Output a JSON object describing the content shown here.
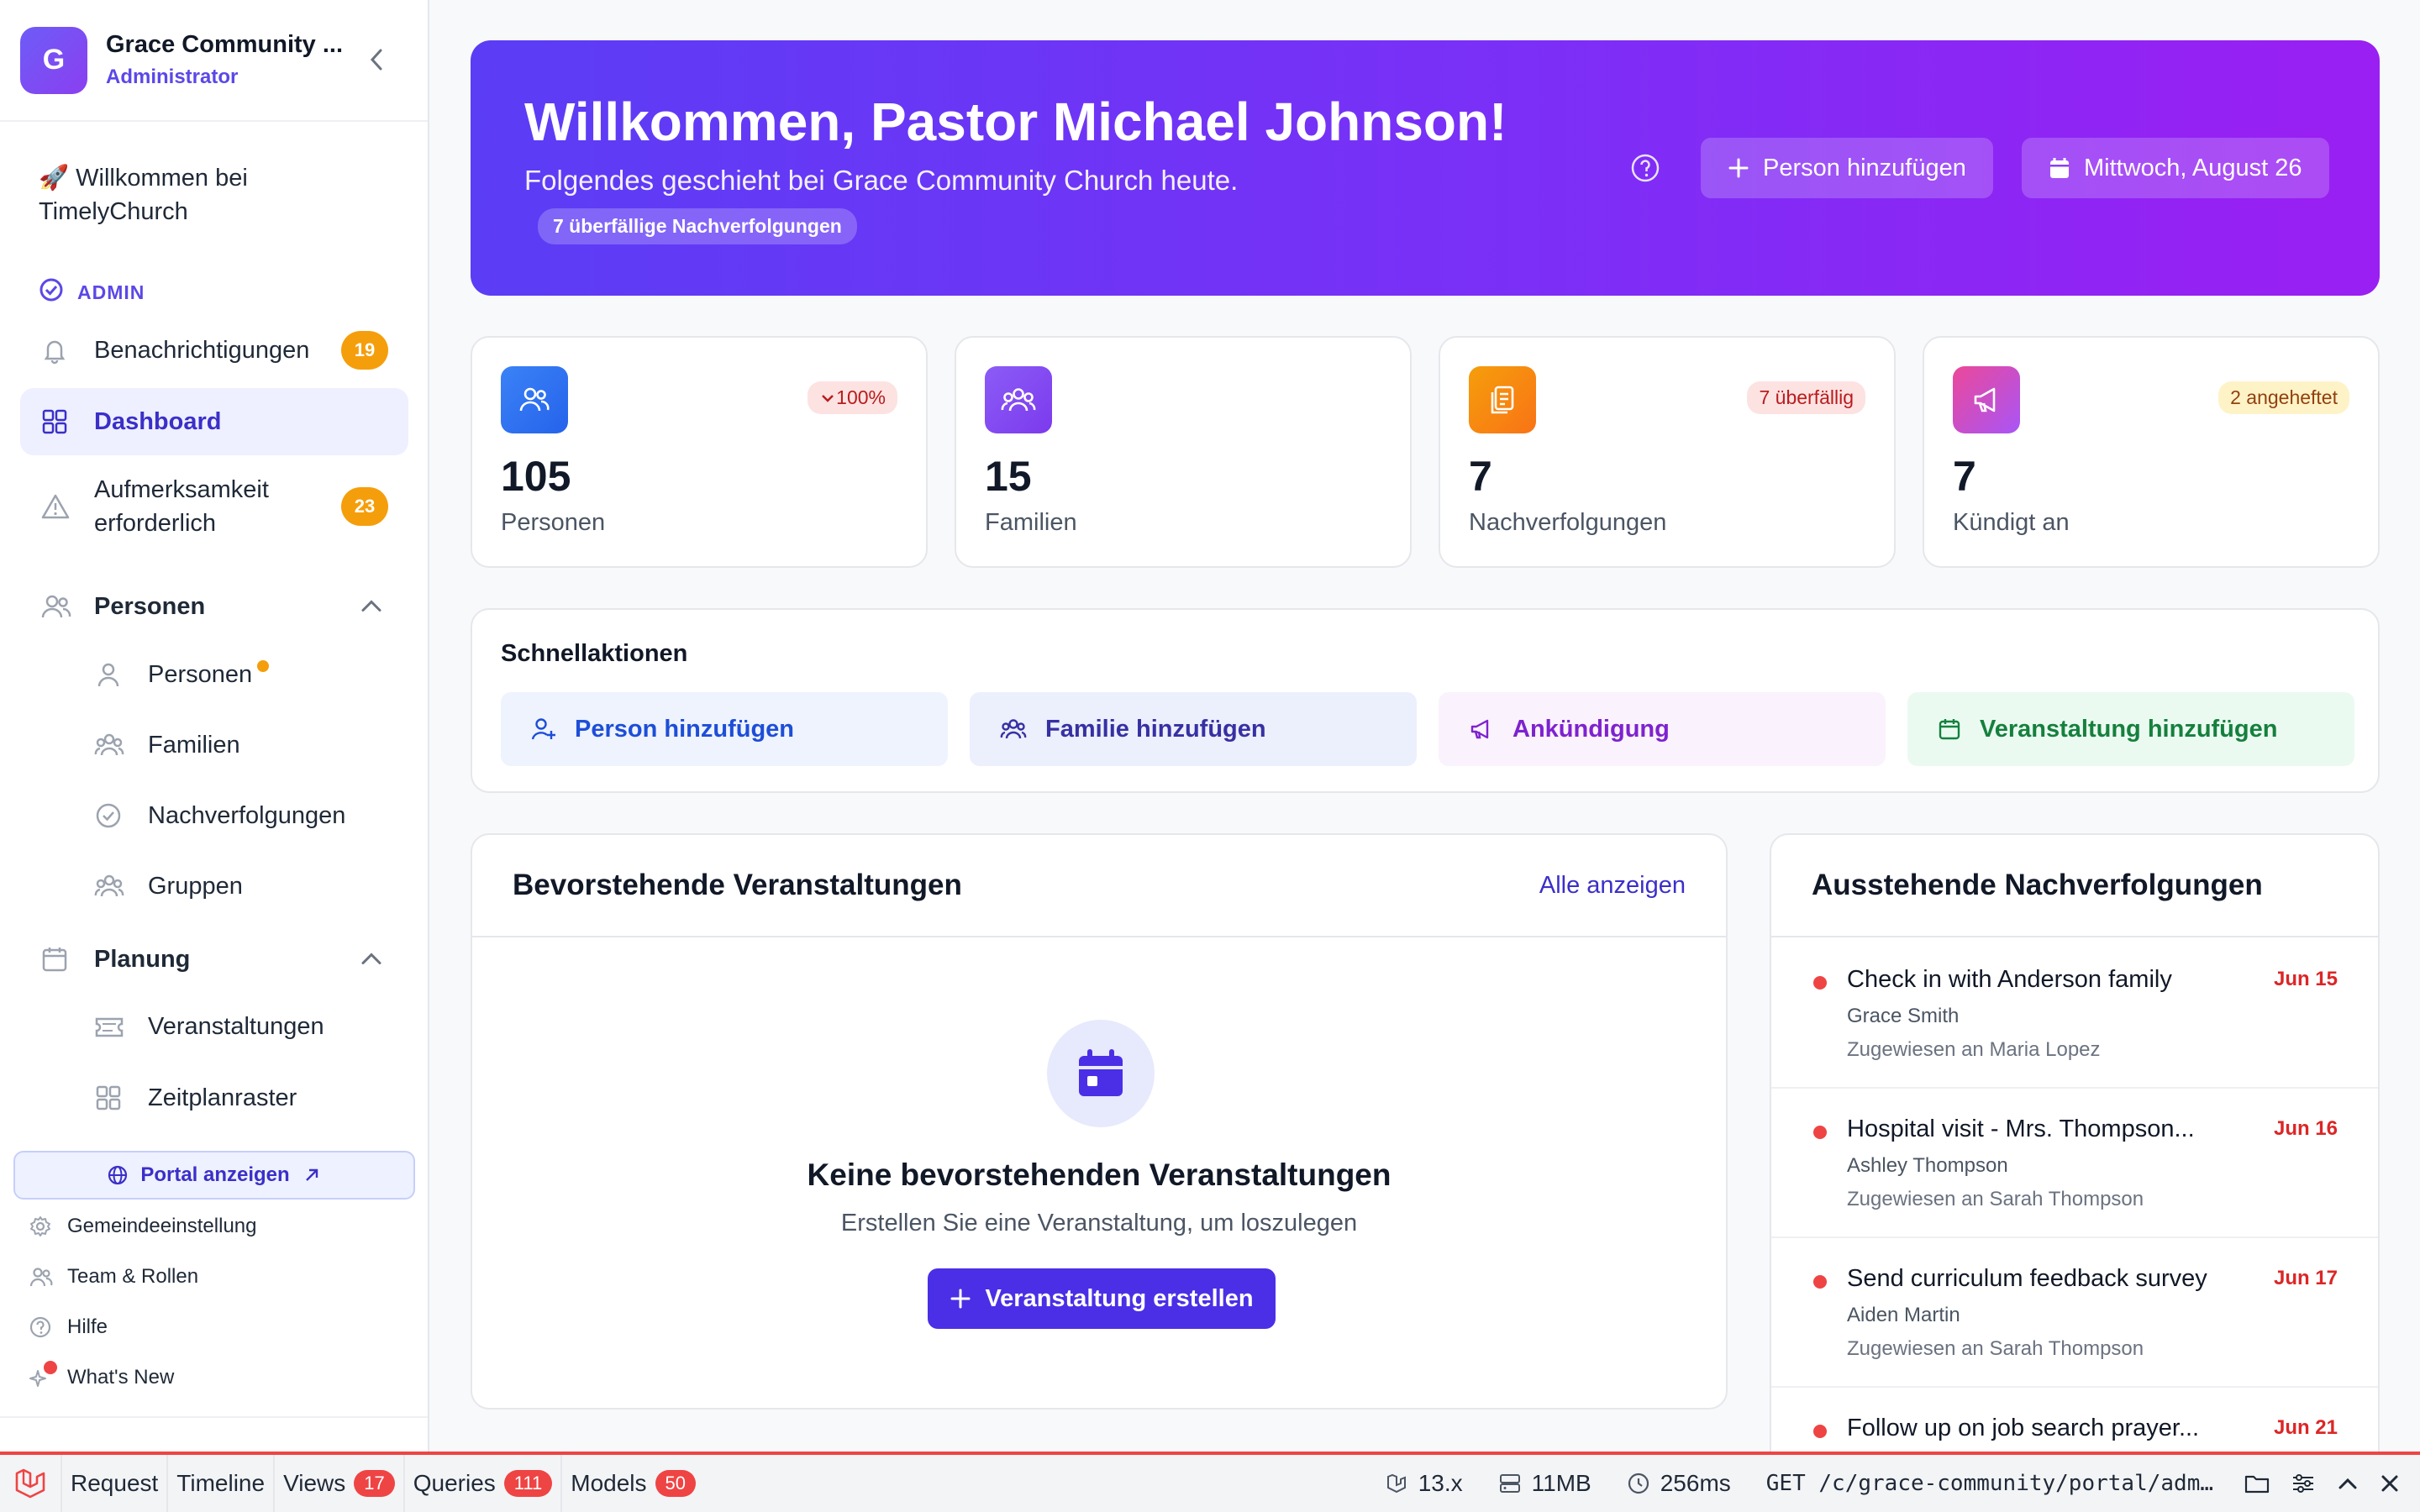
{
  "sidebar": {
    "org_initial": "G",
    "org_name": "Grace Community ...",
    "org_role": "Administrator",
    "welcome": "🚀 Willkommen bei TimelyChurch",
    "admin_label": "ADMIN",
    "notifications": {
      "label": "Benachrichtigungen",
      "count": "19"
    },
    "dashboard": {
      "label": "Dashboard"
    },
    "attention": {
      "label": "Aufmerksamkeit erforderlich",
      "count": "23"
    },
    "people_section": "Personen",
    "people_items": [
      "Personen",
      "Familien",
      "Nachverfolgungen",
      "Gruppen"
    ],
    "planning_section": "Planung",
    "planning_items": [
      "Veranstaltungen",
      "Zeitplanraster"
    ],
    "portal": "Portal anzeigen",
    "footer_items": [
      "Gemeindeeinstellung",
      "Team & Rollen",
      "Hilfe",
      "What's New"
    ]
  },
  "hero": {
    "title": "Willkommen, Pastor Michael Johnson!",
    "subtitle": "Folgendes geschieht bei Grace Community Church heute.",
    "pill": "7 überfällige Nachverfolgungen",
    "add_person": "Person hinzufügen",
    "date": "Mittwoch, August 26"
  },
  "stats": [
    {
      "value": "105",
      "label": "Personen",
      "tag": "100%"
    },
    {
      "value": "15",
      "label": "Familien",
      "tag": ""
    },
    {
      "value": "7",
      "label": "Nachverfolgungen",
      "tag": "7 überfällig"
    },
    {
      "value": "7",
      "label": "Kündigt an",
      "tag": "2 angeheftet"
    }
  ],
  "quick": {
    "title": "Schnellaktionen",
    "actions": [
      "Person hinzufügen",
      "Familie hinzufügen",
      "Ankündigung",
      "Veranstaltung hinzufügen"
    ]
  },
  "events": {
    "title": "Bevorstehende Veranstaltungen",
    "view_all": "Alle anzeigen",
    "empty_title": "Keine bevorstehenden Veranstaltungen",
    "empty_sub": "Erstellen Sie eine Veranstaltung, um loszulegen",
    "create": "Veranstaltung erstellen"
  },
  "followups": {
    "title": "Ausstehende Nachverfolgungen",
    "items": [
      {
        "title": "Check in with Anderson family",
        "person": "Grace Smith",
        "assigned": "Zugewiesen an Maria Lopez",
        "date": "Jun 15"
      },
      {
        "title": "Hospital visit - Mrs. Thompson...",
        "person": "Ashley Thompson",
        "assigned": "Zugewiesen an Sarah Thompson",
        "date": "Jun 16"
      },
      {
        "title": "Send curriculum feedback survey",
        "person": "Aiden Martin",
        "assigned": "Zugewiesen an Sarah Thompson",
        "date": "Jun 17"
      },
      {
        "title": "Follow up on job search prayer...",
        "person": "",
        "assigned": "",
        "date": "Jun 21"
      }
    ]
  },
  "debugbar": {
    "tabs": [
      {
        "label": "Request",
        "count": ""
      },
      {
        "label": "Timeline",
        "count": ""
      },
      {
        "label": "Views",
        "count": "17"
      },
      {
        "label": "Queries",
        "count": "111"
      },
      {
        "label": "Models",
        "count": "50"
      }
    ],
    "version": "13.x",
    "memory": "11MB",
    "time": "256ms",
    "route": "GET /c/grace-community/portal/adm…"
  },
  "colors": {
    "accent": "#4a2fe6",
    "badge": "#f59e0b",
    "danger": "#ef4444"
  }
}
